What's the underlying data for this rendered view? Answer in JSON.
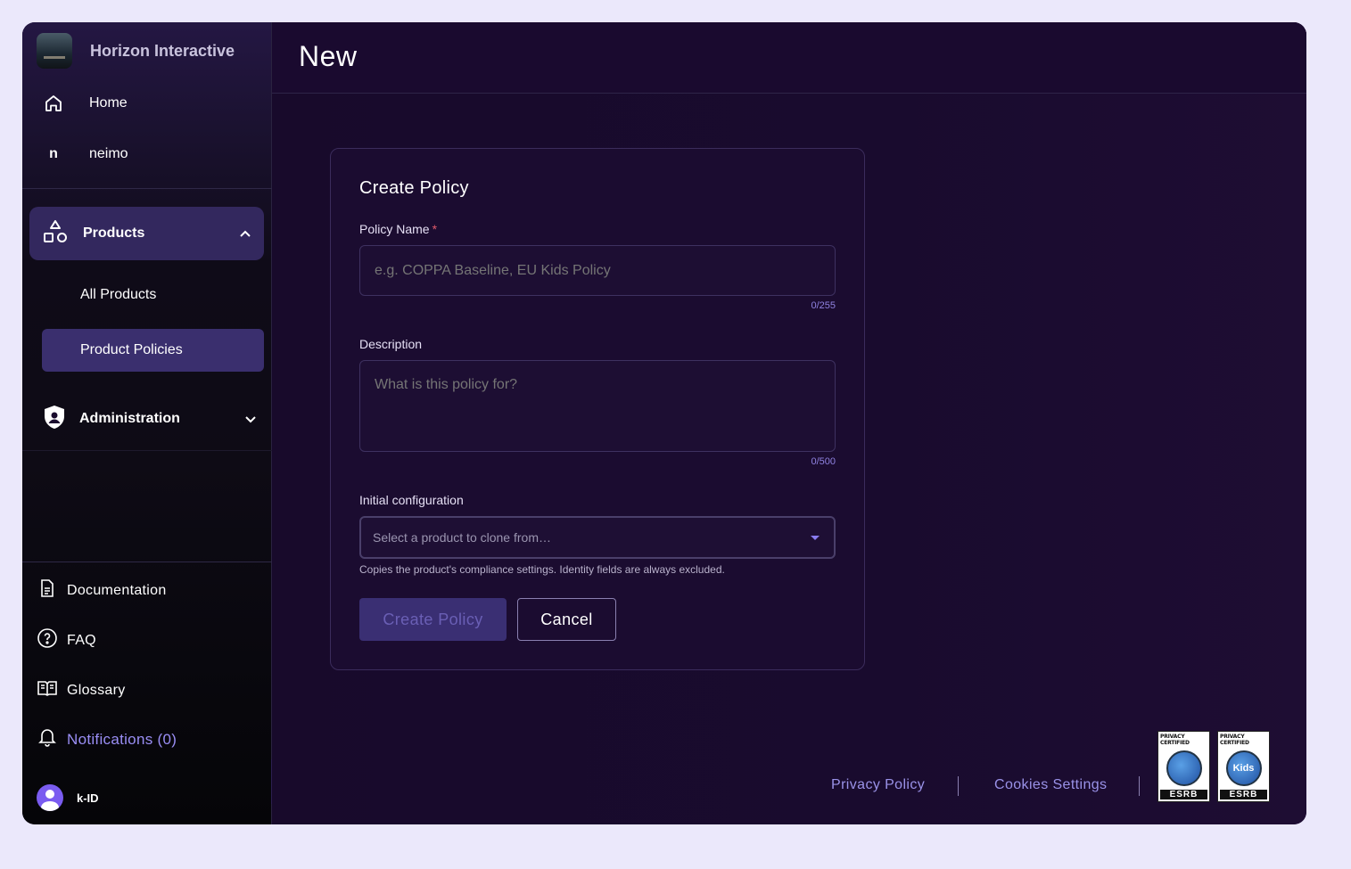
{
  "brand": {
    "name": "Horizon Interactive"
  },
  "sidebar": {
    "top_items": [
      {
        "label": "Home",
        "icon": "home-icon"
      },
      {
        "label": "neimo",
        "icon_letter": "n"
      }
    ],
    "products": {
      "label": "Products",
      "icon": "shapes-icon",
      "expanded": true,
      "sub_items": [
        {
          "label": "All Products"
        },
        {
          "label": "Product Policies",
          "active": true
        }
      ]
    },
    "administration": {
      "label": "Administration",
      "icon": "shield-user-icon"
    },
    "bottom_items": [
      {
        "label": "Documentation",
        "icon": "document-icon"
      },
      {
        "label": "FAQ",
        "icon": "question-circle-icon"
      },
      {
        "label": "Glossary",
        "icon": "book-icon"
      },
      {
        "label": "Notifications (0)",
        "icon": "bell-icon"
      }
    ],
    "user": {
      "name": "k-ID"
    }
  },
  "header": {
    "title": "New"
  },
  "form": {
    "title": "Create Policy",
    "policy_name": {
      "label": "Policy Name",
      "required_marker": "*",
      "placeholder": "e.g. COPPA Baseline, EU Kids Policy",
      "counter": "0/255"
    },
    "description": {
      "label": "Description",
      "placeholder": "What is this policy for?",
      "counter": "0/500"
    },
    "initial_config": {
      "label": "Initial configuration",
      "placeholder": "Select a product to clone from…",
      "hint": "Copies the product's compliance settings. Identity fields are always excluded."
    },
    "submit_label": "Create Policy",
    "cancel_label": "Cancel"
  },
  "footer": {
    "privacy_label": "Privacy Policy",
    "cookies_label": "Cookies Settings",
    "seals": [
      {
        "top": "PRIVACY CERTIFIED",
        "bottom": "ESRB",
        "center": ""
      },
      {
        "top": "PRIVACY CERTIFIED",
        "bottom": "ESRB",
        "center": "Kids"
      }
    ]
  },
  "colors": {
    "accent": "#9a8ef5",
    "active_nav": "#3a2f6e",
    "products_bg": "#33285e",
    "background": "#190b2e"
  }
}
